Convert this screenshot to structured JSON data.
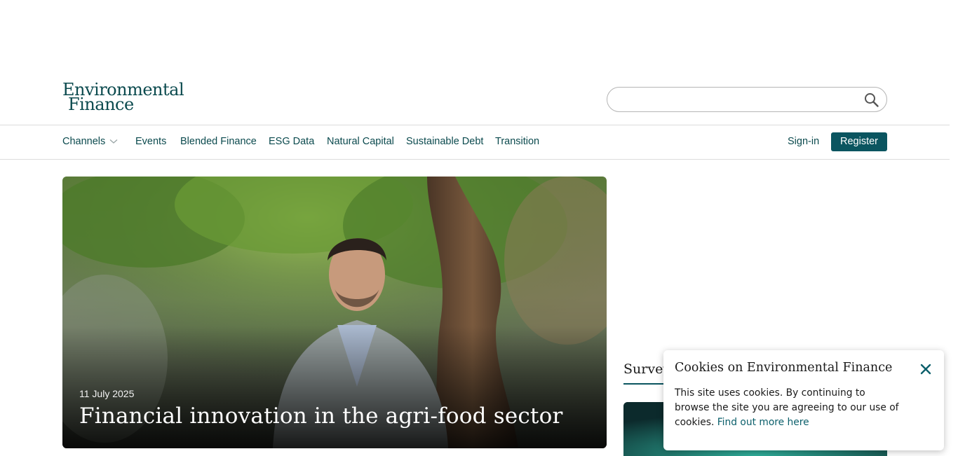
{
  "brand": {
    "logo_line1": "Environmental",
    "logo_line2": "Finance",
    "color": "#0b4a4e"
  },
  "search": {
    "placeholder": "",
    "value": "",
    "icon": "search-icon"
  },
  "nav": {
    "channels_label": "Channels",
    "items": [
      "Events",
      "Blended Finance",
      "ESG Data",
      "Natural Capital",
      "Sustainable Debt",
      "Transition"
    ],
    "signin_label": "Sign-in",
    "register_label": "Register",
    "accent_color": "#0b5560"
  },
  "hero": {
    "date": "11 July 2025",
    "headline": "Financial innovation in the agri-food sector"
  },
  "sidebar": {
    "survey_heading": "Survey"
  },
  "cookie_banner": {
    "title": "Cookies on Environmental Finance",
    "text": "This site uses cookies. By continuing to browse the site you are agreeing to our use of cookies.",
    "link_text": "Find out more here",
    "close_icon": "close-icon"
  }
}
